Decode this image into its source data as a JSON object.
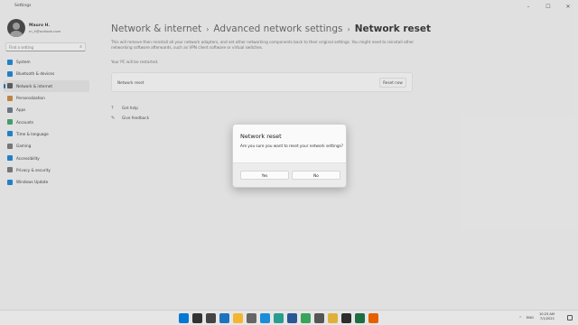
{
  "window": {
    "title": "Settings",
    "controls": [
      "–",
      "☐",
      "✕"
    ]
  },
  "profile": {
    "name": "Mauro H.",
    "email": "m_h@outlook.com"
  },
  "search": {
    "placeholder": "Find a setting"
  },
  "sidebar": {
    "items": [
      {
        "label": "System",
        "icon": "monitor-icon",
        "color": "#0078d4"
      },
      {
        "label": "Bluetooth & devices",
        "icon": "bluetooth-icon",
        "color": "#0078d4"
      },
      {
        "label": "Network & internet",
        "icon": "network-icon",
        "color": "#4a4a4a",
        "active": true
      },
      {
        "label": "Personalization",
        "icon": "brush-icon",
        "color": "#c77b2a"
      },
      {
        "label": "Apps",
        "icon": "apps-icon",
        "color": "#5a6b7d"
      },
      {
        "label": "Accounts",
        "icon": "accounts-icon",
        "color": "#2e9d5b"
      },
      {
        "label": "Time & language",
        "icon": "clock-globe-icon",
        "color": "#0078d4"
      },
      {
        "label": "Gaming",
        "icon": "gamepad-icon",
        "color": "#6b6b6b"
      },
      {
        "label": "Accessibility",
        "icon": "accessibility-icon",
        "color": "#0078d4"
      },
      {
        "label": "Privacy & security",
        "icon": "shield-icon",
        "color": "#6b6b6b"
      },
      {
        "label": "Windows Update",
        "icon": "update-icon",
        "color": "#0078d4"
      }
    ]
  },
  "breadcrumb": {
    "level1": "Network & internet",
    "level2": "Advanced network settings",
    "current": "Network reset",
    "separator": "›"
  },
  "content": {
    "description_line1": "This will remove then reinstall all your network adapters, and set other networking components back to their original settings. You might need to reinstall other",
    "description_line2": "networking software afterwards, such as VPN client software or virtual switches.",
    "note": "Your PC will be restarted.",
    "card_label": "Network reset",
    "card_button": "Reset now",
    "links": [
      {
        "label": "Get help",
        "icon": "help-icon"
      },
      {
        "label": "Give feedback",
        "icon": "feedback-icon"
      }
    ]
  },
  "dialog": {
    "title": "Network reset",
    "message": "Are you sure you want to reset your network settings?",
    "yes_label": "Yes",
    "no_label": "No"
  },
  "taskbar": {
    "apps": [
      {
        "icon": "start-icon",
        "color": "#0078d4"
      },
      {
        "icon": "search-icon",
        "color": "#333333"
      },
      {
        "icon": "task-view-icon",
        "color": "#444444"
      },
      {
        "icon": "widgets-icon",
        "color": "#1e73be"
      },
      {
        "icon": "file-explorer-icon",
        "color": "#f2b632"
      },
      {
        "icon": "settings-icon",
        "color": "#666666"
      },
      {
        "icon": "edge-icon",
        "color": "#1a8dd8"
      },
      {
        "icon": "edge-dev-icon",
        "color": "#2a9d8f"
      },
      {
        "icon": "store-icon",
        "color": "#2b5797"
      },
      {
        "icon": "snipping-icon",
        "color": "#3aa35c"
      },
      {
        "icon": "calculator-icon",
        "color": "#555555"
      },
      {
        "icon": "notepad-icon",
        "color": "#e0b13a"
      },
      {
        "icon": "terminal-icon",
        "color": "#2d2d2d"
      },
      {
        "icon": "excel-icon",
        "color": "#1d6f42"
      },
      {
        "icon": "firefox-icon",
        "color": "#e66000"
      }
    ],
    "tray": {
      "chevron": "^",
      "language": "ENG",
      "time": "10:23 AM",
      "date": "7/1/2021"
    }
  }
}
